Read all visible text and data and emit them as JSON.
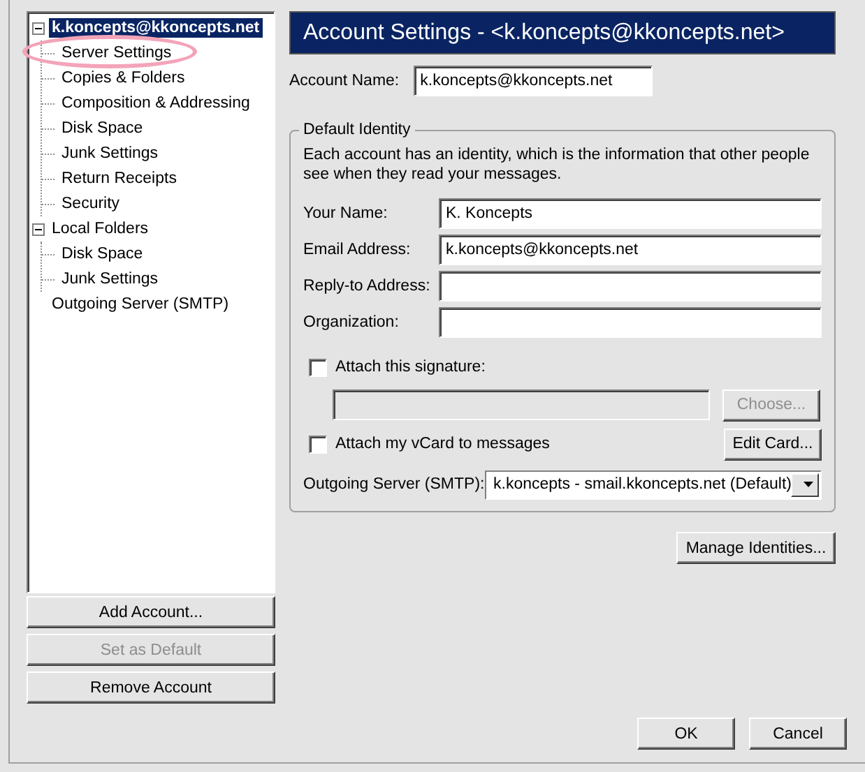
{
  "tree": [
    {
      "label": "k.koncepts@kkoncepts.net",
      "selected": true,
      "expanded": true,
      "circled": false,
      "children": [
        {
          "label": "Server Settings",
          "selected": false,
          "circled": true
        },
        {
          "label": "Copies & Folders",
          "selected": false,
          "circled": false
        },
        {
          "label": "Composition & Addressing",
          "selected": false,
          "circled": false
        },
        {
          "label": "Disk Space",
          "selected": false,
          "circled": false
        },
        {
          "label": "Junk Settings",
          "selected": false,
          "circled": false
        },
        {
          "label": "Return Receipts",
          "selected": false,
          "circled": false
        },
        {
          "label": "Security",
          "selected": false,
          "circled": false
        }
      ]
    },
    {
      "label": "Local Folders",
      "selected": false,
      "expanded": true,
      "circled": false,
      "children": [
        {
          "label": "Disk Space",
          "selected": false,
          "circled": false
        },
        {
          "label": "Junk Settings",
          "selected": false,
          "circled": false
        }
      ]
    },
    {
      "label": "Outgoing Server (SMTP)",
      "selected": false,
      "circled": false
    }
  ],
  "account_buttons": [
    {
      "label": "Add Account...",
      "disabled": false
    },
    {
      "label": "Set as Default",
      "disabled": true
    },
    {
      "label": "Remove Account",
      "disabled": false
    }
  ],
  "header": {
    "title": "Account Settings - <k.koncepts@kkoncepts.net>"
  },
  "account_name": {
    "label": "Account Name:",
    "value": "k.koncepts@kkoncepts.net"
  },
  "identity": {
    "legend": "Default Identity",
    "description": "Each account has an identity, which is the information that other people see when they read your messages.",
    "fields": [
      {
        "label": "Your Name:",
        "value": "K. Koncepts"
      },
      {
        "label": "Email Address:",
        "value": "k.koncepts@kkoncepts.net"
      },
      {
        "label": "Reply-to Address:"
      },
      {
        "label": "Organization:"
      }
    ],
    "signature": {
      "label": "Attach this signature:",
      "checked": false,
      "disabled": true,
      "button": {
        "label": "Choose...",
        "disabled": true
      }
    },
    "vcard": {
      "label": "Attach my vCard to messages",
      "checked": false,
      "button": {
        "label": "Edit Card...",
        "disabled": false
      }
    },
    "outgoing": {
      "label": "Outgoing Server (SMTP):",
      "value": "k.koncepts - smail.kkoncepts.net (Default)"
    }
  },
  "manage_button": {
    "label": "Manage Identities..."
  },
  "dialog_buttons": [
    {
      "label": "OK"
    },
    {
      "label": "Cancel"
    }
  ]
}
